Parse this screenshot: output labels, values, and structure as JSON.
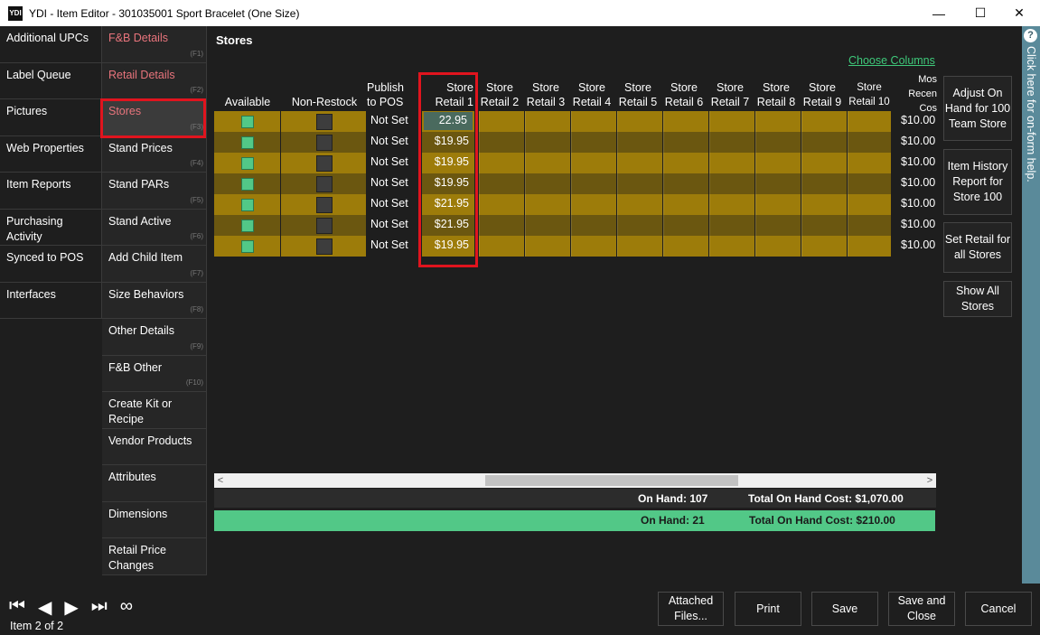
{
  "window": {
    "logo": "YDI",
    "title": "YDI - Item Editor - 301035001 Sport Bracelet (One Size)",
    "minimize": "—",
    "maximize": "☐",
    "close": "✕"
  },
  "nav_left": [
    {
      "label": "Additional UPCs"
    },
    {
      "label": "Label Queue"
    },
    {
      "label": "Pictures"
    },
    {
      "label": "Web Properties"
    },
    {
      "label": "Item Reports"
    },
    {
      "label": "Purchasing Activity"
    },
    {
      "label": "Synced to POS"
    },
    {
      "label": "Interfaces"
    }
  ],
  "nav_right": [
    {
      "label": "F&B Details",
      "fkey": "(F1)"
    },
    {
      "label": "Retail Details",
      "fkey": "(F2)"
    },
    {
      "label": "Stores",
      "fkey": "(F3)"
    },
    {
      "label": "Stand Prices",
      "fkey": "(F4)"
    },
    {
      "label": "Stand PARs",
      "fkey": "(F5)"
    },
    {
      "label": "Stand Active",
      "fkey": "(F6)"
    },
    {
      "label": "Add Child Item",
      "fkey": "(F7)"
    },
    {
      "label": "Size Behaviors",
      "fkey": "(F8)"
    },
    {
      "label": "Other Details",
      "fkey": "(F9)"
    },
    {
      "label": "F&B Other",
      "fkey": "(F10)"
    },
    {
      "label": "Create Kit or Recipe",
      "fkey": ""
    },
    {
      "label": "Vendor Products",
      "fkey": ""
    },
    {
      "label": "Attributes",
      "fkey": ""
    },
    {
      "label": "Dimensions",
      "fkey": ""
    },
    {
      "label": "Retail Price Changes",
      "fkey": ""
    }
  ],
  "main": {
    "section_title": "Stores",
    "choose_columns": "Choose Columns"
  },
  "grid": {
    "headers": {
      "available": "Available",
      "non_restock": "Non-Restock",
      "publish": "Publish to POS",
      "r1": "Store Retail 1",
      "r2": "Store Retail 2",
      "r3": "Store Retail 3",
      "r4": "Store Retail 4",
      "r5": "Store Retail 5",
      "r6": "Store Retail 6",
      "r7": "Store Retail 7",
      "r8": "Store Retail 8",
      "r9": "Store Retail 9",
      "r10": "Store Retail 10",
      "most_recent": "Mos Recen Cos"
    },
    "rows": [
      {
        "available": true,
        "non_restock": false,
        "publish": "Not Set",
        "retail1": "22.95",
        "most_recent": "$10.00"
      },
      {
        "available": true,
        "non_restock": false,
        "publish": "Not Set",
        "retail1": "$19.95",
        "most_recent": "$10.00"
      },
      {
        "available": true,
        "non_restock": false,
        "publish": "Not Set",
        "retail1": "$19.95",
        "most_recent": "$10.00"
      },
      {
        "available": true,
        "non_restock": false,
        "publish": "Not Set",
        "retail1": "$19.95",
        "most_recent": "$10.00"
      },
      {
        "available": true,
        "non_restock": false,
        "publish": "Not Set",
        "retail1": "$21.95",
        "most_recent": "$10.00"
      },
      {
        "available": true,
        "non_restock": false,
        "publish": "Not Set",
        "retail1": "$21.95",
        "most_recent": "$10.00"
      },
      {
        "available": true,
        "non_restock": false,
        "publish": "Not Set",
        "retail1": "$19.95",
        "most_recent": "$10.00"
      }
    ]
  },
  "totals": {
    "row1_on_hand": "On Hand: 107",
    "row1_cost": "Total On Hand Cost: $1,070.00",
    "row2_on_hand": "On Hand: 21",
    "row2_cost": "Total On Hand Cost: $210.00"
  },
  "side_buttons": {
    "adjust": "Adjust On Hand for 100 Team Store",
    "history": "Item History Report for Store 100",
    "set_retail": "Set Retail for all Stores",
    "show_all": "Show All Stores"
  },
  "help": {
    "icon": "?",
    "text": "Click here for on-form help."
  },
  "footer": {
    "first": "⏮",
    "prev": "◀",
    "next": "▶",
    "last": "⏭",
    "all": "∞",
    "item_counter": "Item 2 of 2",
    "attached_files": "Attached Files...",
    "print": "Print",
    "save": "Save",
    "save_close": "Save and Close",
    "cancel": "Cancel"
  },
  "colors": {
    "row_gold_light": "#9d7c0a",
    "row_gold_dark": "#6b5710",
    "accent_green": "#52c887",
    "highlight_red": "#e0141e"
  }
}
